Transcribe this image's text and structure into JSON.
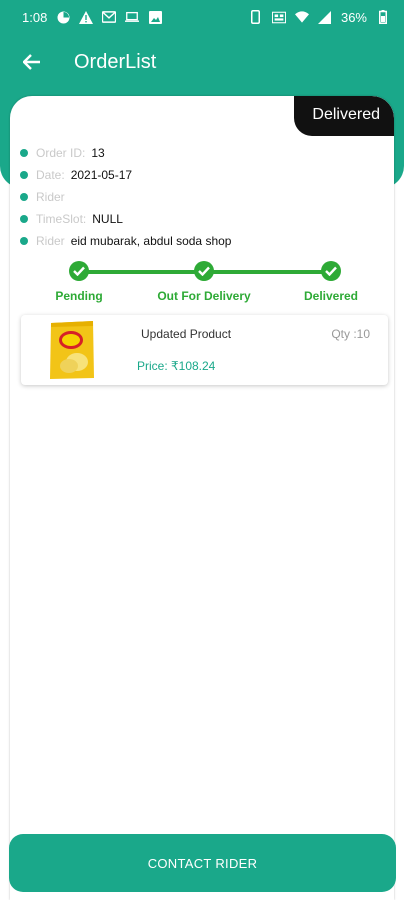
{
  "status_bar": {
    "time": "1:08",
    "battery": "36%",
    "icons": [
      "data-saver-icon",
      "warning-icon",
      "gmail-icon",
      "laptop-icon",
      "image-icon",
      "phone-icon",
      "vibrate-icon",
      "wifi-icon",
      "signal-icon",
      "battery-icon"
    ]
  },
  "app_bar": {
    "title": "OrderList",
    "back_icon": "arrow-left-icon"
  },
  "order": {
    "status_badge": "Delivered",
    "details": [
      {
        "label": "Order ID:",
        "value": "13"
      },
      {
        "label": "Date:",
        "value": "2021-05-17"
      },
      {
        "label": "Rider",
        "value": ""
      },
      {
        "label": "TimeSlot:",
        "value": "NULL"
      },
      {
        "label": "Rider",
        "value": "eid mubarak, abdul soda shop"
      }
    ],
    "steps": [
      "Pending",
      "Out For Delivery",
      "Delivered"
    ],
    "progress": 1.0
  },
  "product": {
    "name": "Updated Product",
    "qty": "Qty :10",
    "price": "Price: ₹108.24"
  },
  "contact_button": "CONTACT RIDER",
  "colors": {
    "primary": "#1aa88a",
    "step_green": "#2eaa36",
    "badge_bg": "#111111"
  }
}
